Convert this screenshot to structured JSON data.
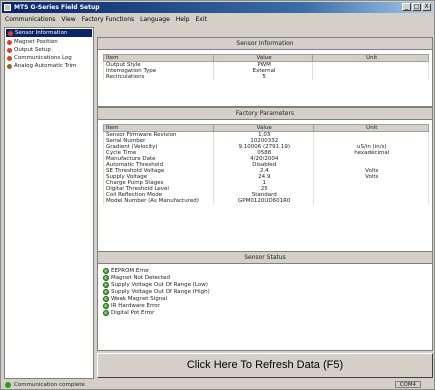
{
  "window": {
    "title": "MTS G-Series Field Setup",
    "min": "_",
    "max": "□",
    "close": "X"
  },
  "menu": [
    "Communications",
    "View",
    "Factory Functions",
    "Language",
    "Help",
    "Exit"
  ],
  "sidebar": {
    "items": [
      {
        "label": "Sensor Information",
        "color": "#e04020",
        "selected": true
      },
      {
        "label": "Magnet Position",
        "color": "#e04020",
        "selected": false
      },
      {
        "label": "Output Setup",
        "color": "#e04020",
        "selected": false
      },
      {
        "label": "Communications Log",
        "color": "#e04020",
        "selected": false
      },
      {
        "label": "Analog Automatic Trim",
        "color": "#8a6a20",
        "selected": false
      }
    ]
  },
  "sensor_info": {
    "title": "Sensor Information",
    "headers": [
      "Item",
      "Value",
      "Unit"
    ],
    "rows": [
      [
        "Output Style",
        "PWM",
        ""
      ],
      [
        "Interrogation Type",
        "External",
        ""
      ],
      [
        "Recirculations",
        "5",
        ""
      ]
    ]
  },
  "factory": {
    "title": "Factory Parameters",
    "headers": [
      "Item",
      "Value",
      "Unit"
    ],
    "rows": [
      [
        "Sensor Firmware Revision",
        "1.03",
        ""
      ],
      [
        "Serial Number",
        "10200332",
        ""
      ],
      [
        "Gradient (Velocity)",
        "9.10006 (2791.19)",
        "uS/in (in/s)"
      ],
      [
        "Cycle Time",
        "0588",
        "hexadecimal"
      ],
      [
        "Manufacture Date",
        "4/20/2004",
        ""
      ],
      [
        "Automatic Threshold",
        "Disabled",
        ""
      ],
      [
        "SE Threshold Voltage",
        "2.4",
        "Volts"
      ],
      [
        "Supply Voltage",
        "24.9",
        "Volts"
      ],
      [
        "Charge Pump Stages",
        "1",
        ""
      ],
      [
        "Digital Threshold Level",
        "25",
        ""
      ],
      [
        "Coil Reflection Mode",
        "Standard",
        ""
      ],
      [
        "Model Number (As Manufactured)",
        "GPM0120UD601R0",
        ""
      ]
    ]
  },
  "status": {
    "title": "Sensor Status",
    "items": [
      "EEPROM Error",
      "Magnet Not Detected",
      "Supply Voltage Out Of Range (Low)",
      "Supply Voltage Out Of Range (High)",
      "Weak Magnet Signal",
      "IR Hardware Error",
      "Digital Pot Error"
    ]
  },
  "refresh_label": "Click Here To Refresh Data (F5)",
  "statusbar": {
    "message": "Communication complete",
    "port": "COM4"
  }
}
